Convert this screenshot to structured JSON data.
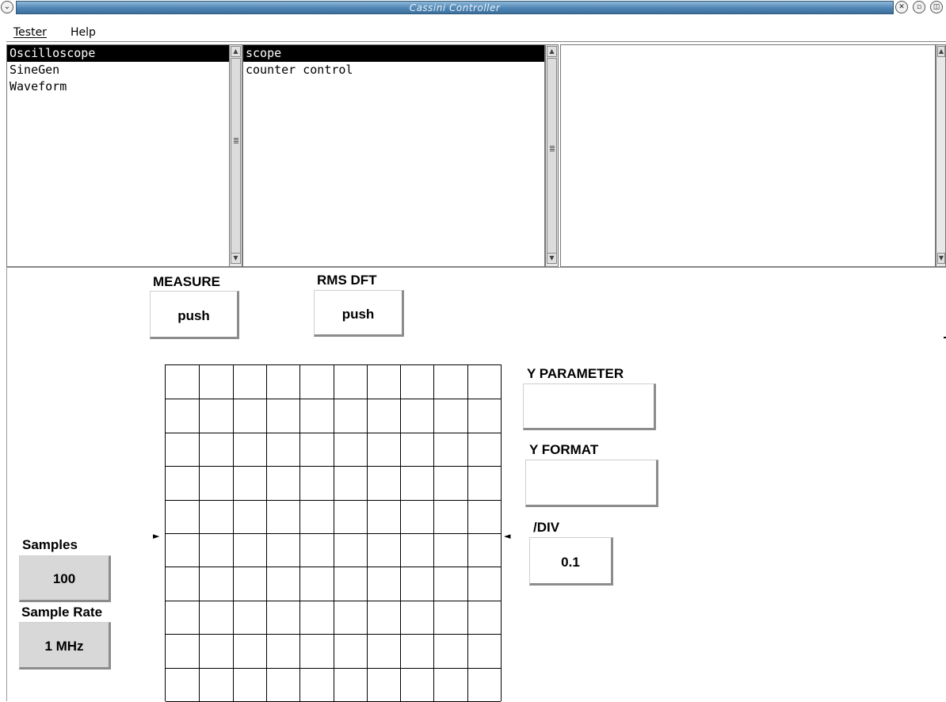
{
  "window": {
    "title": "Cassini Controller",
    "menu_icon": "chevron-down-icon",
    "controls": [
      "close-icon",
      "minimize-icon",
      "maximize-icon"
    ]
  },
  "menubar": {
    "items": [
      {
        "label": "Tester",
        "mnemonic": "T"
      },
      {
        "label": "Help",
        "mnemonic": "H"
      }
    ]
  },
  "lists": {
    "testers": {
      "items": [
        "Oscilloscope",
        "SineGen",
        "Waveform"
      ],
      "selected": "Oscilloscope"
    },
    "panels": {
      "items": [
        "scope",
        "counter control"
      ],
      "selected": "scope"
    },
    "third": {
      "items": []
    }
  },
  "panel": {
    "measure": {
      "label": "MEASURE",
      "button": "push"
    },
    "rms_dft": {
      "label": "RMS DFT",
      "button": "push"
    },
    "y_parameter": {
      "label": "Y PARAMETER",
      "value": ""
    },
    "y_format": {
      "label": "Y FORMAT",
      "value": ""
    },
    "per_div": {
      "label": "/DIV",
      "value": "0.1"
    },
    "samples": {
      "label": "Samples",
      "value": "100"
    },
    "sample_rate": {
      "label": "Sample Rate",
      "value": "1 MHz"
    },
    "scope_grid": {
      "columns": 10,
      "rows": 10
    }
  },
  "colors": {
    "title_bar": "#4f86b5",
    "selection": "#000000",
    "button_shadow": "#8c8c8c",
    "value_button_bg": "#d8d8d8"
  }
}
